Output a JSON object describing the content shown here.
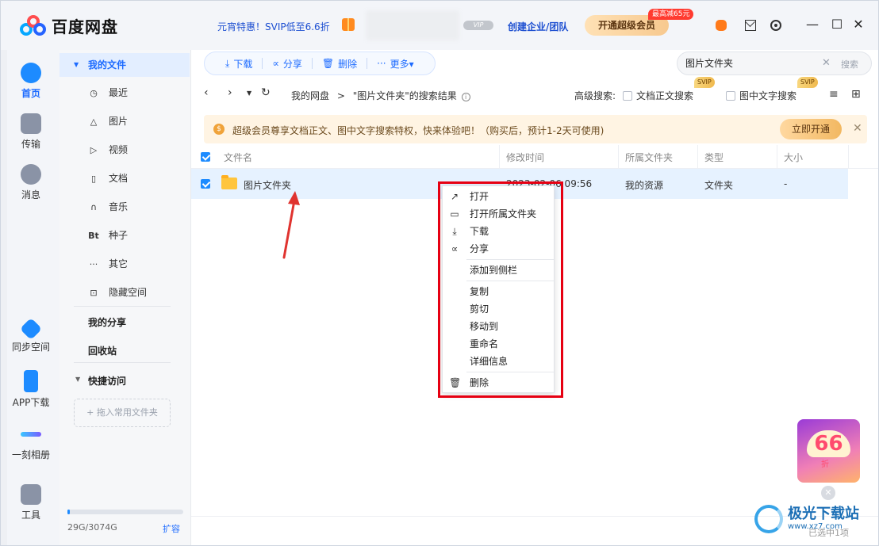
{
  "app": {
    "title": "百度网盘",
    "promo_text": "元宵特惠！SVIP低至6.6折",
    "vip_badge": "VIP",
    "enterprise_link": "创建企业/团队",
    "svip_button": "开通超级会员",
    "discount_tag": "最高减65元"
  },
  "window_controls": {
    "minimize": "—",
    "maximize": "☐",
    "close": "✕"
  },
  "rail": {
    "items": [
      {
        "label": "首页",
        "icon": "home-cloud-icon",
        "active": true
      },
      {
        "label": "传输",
        "icon": "transfer-icon"
      },
      {
        "label": "消息",
        "icon": "message-icon"
      },
      {
        "label": "同步空间",
        "icon": "sync-space-icon"
      },
      {
        "label": "APP下载",
        "icon": "phone-icon"
      },
      {
        "label": "一刻相册",
        "icon": "album-icon"
      },
      {
        "label": "工具",
        "icon": "tools-icon"
      }
    ]
  },
  "nav": {
    "my_files": "我的文件",
    "items": [
      {
        "label": "最近",
        "icon": "clock-icon"
      },
      {
        "label": "图片",
        "icon": "image-icon"
      },
      {
        "label": "视频",
        "icon": "play-icon"
      },
      {
        "label": "文档",
        "icon": "document-icon"
      },
      {
        "label": "音乐",
        "icon": "headphone-icon"
      },
      {
        "label": "种子",
        "icon": "bt-icon"
      },
      {
        "label": "其它",
        "icon": "more-icon"
      },
      {
        "label": "隐藏空间",
        "icon": "lock-icon"
      }
    ],
    "my_share": "我的分享",
    "recycle_bin": "回收站",
    "quick_access": "快捷访问",
    "drop_hint": "+ 拖入常用文件夹",
    "storage": "29G/3074G",
    "storage_fraction": 0.0094,
    "expand": "扩容"
  },
  "toolbar": {
    "download": "下载",
    "share": "分享",
    "delete": "删除",
    "more": "更多▾"
  },
  "search": {
    "value": "图片文件夹",
    "button": "搜索"
  },
  "path": {
    "root": "我的网盘",
    "separator": ">",
    "result": "\"图片文件夹\"的搜索结果",
    "advanced_label": "高级搜索:",
    "option_text_search": "文档正文搜索",
    "option_image_text": "图中文字搜索",
    "svip_tag": "SVIP"
  },
  "banner": {
    "text": "超级会员尊享文档正文、图中文字搜索特权，快来体验吧！（购买后，预计1-2天可使用)",
    "button": "立即开通"
  },
  "table": {
    "headers": [
      "文件名",
      "修改时间",
      "所属文件夹",
      "类型",
      "大小"
    ],
    "rows": [
      {
        "name": "图片文件夹",
        "modified": "2023-02-06 09:56",
        "folder": "我的资源",
        "type": "文件夹",
        "size": "-"
      }
    ]
  },
  "context_menu": {
    "items": [
      {
        "label": "打开",
        "icon": "open-arrow-icon"
      },
      {
        "label": "打开所属文件夹",
        "icon": "folder-outline-icon"
      },
      {
        "label": "下载",
        "icon": "download-icon"
      },
      {
        "label": "分享",
        "icon": "share-icon"
      },
      {
        "label": "添加到侧栏"
      },
      {
        "label": "复制"
      },
      {
        "label": "剪切"
      },
      {
        "label": "移动到"
      },
      {
        "label": "重命名"
      },
      {
        "label": "详细信息"
      },
      {
        "label": "删除",
        "icon": "trash-icon"
      }
    ]
  },
  "status": {
    "selected": "已选中1项"
  },
  "float_promo": {
    "number": "66",
    "sub": "折"
  },
  "watermark": {
    "title": "极光下载站",
    "sub": "www.xz7.com"
  },
  "colors": {
    "accent": "#1d6bff",
    "highlight_frame": "#e60012",
    "row_selected": "#e6f2ff"
  }
}
